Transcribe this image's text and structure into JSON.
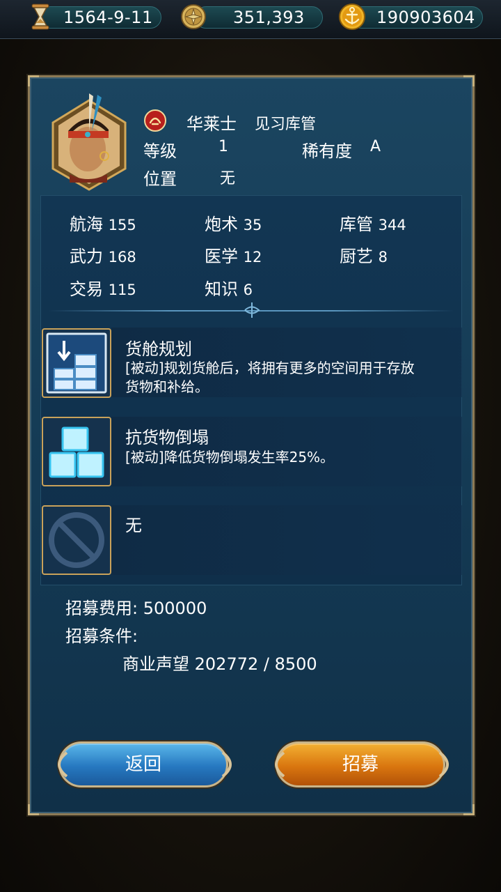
{
  "topbar": {
    "date": "1564-9-11",
    "coins": "351,393",
    "gold": "190903604",
    "icons": [
      "hourglass-icon",
      "compass-coin-icon",
      "anchor-gold-icon"
    ]
  },
  "officer": {
    "name": "华莱士",
    "title": "见习库管",
    "level_label": "等级",
    "level": "1",
    "rarity_label": "稀有度",
    "rarity": "A",
    "position_label": "位置",
    "position": "无"
  },
  "stats": [
    {
      "label": "航海",
      "value": "155"
    },
    {
      "label": "炮术",
      "value": "35"
    },
    {
      "label": "库管",
      "value": "344"
    },
    {
      "label": "武力",
      "value": "168"
    },
    {
      "label": "医学",
      "value": "12"
    },
    {
      "label": "厨艺",
      "value": "8"
    },
    {
      "label": "交易",
      "value": "115"
    },
    {
      "label": "知识",
      "value": "6"
    }
  ],
  "skills": [
    {
      "name": "货舱规划",
      "desc_line1": "[被动]规划货舱后，将拥有更多的空间用于存放",
      "desc_line2": "货物和补给。",
      "icon": "cargo-stack-icon"
    },
    {
      "name": "抗货物倒塌",
      "desc_line1": "[被动]降低货物倒塌发生率25%。",
      "desc_line2": "",
      "icon": "cube-stack-icon"
    },
    {
      "name": "无",
      "desc_line1": "",
      "desc_line2": "",
      "icon": "none-icon"
    }
  ],
  "recruit": {
    "cost_label": "招募费用:",
    "cost_value": "500000",
    "cond_label": "招募条件:",
    "cond_name": "商业声望",
    "cond_value": "202772 / 8500"
  },
  "buttons": {
    "back": "返回",
    "recruit": "招募"
  },
  "colors": {
    "panel": "#1b4560",
    "border": "#8d7a55",
    "back_button": "#2678c0",
    "recruit_button": "#d9760f",
    "skill_frame": "#c9a25a"
  }
}
